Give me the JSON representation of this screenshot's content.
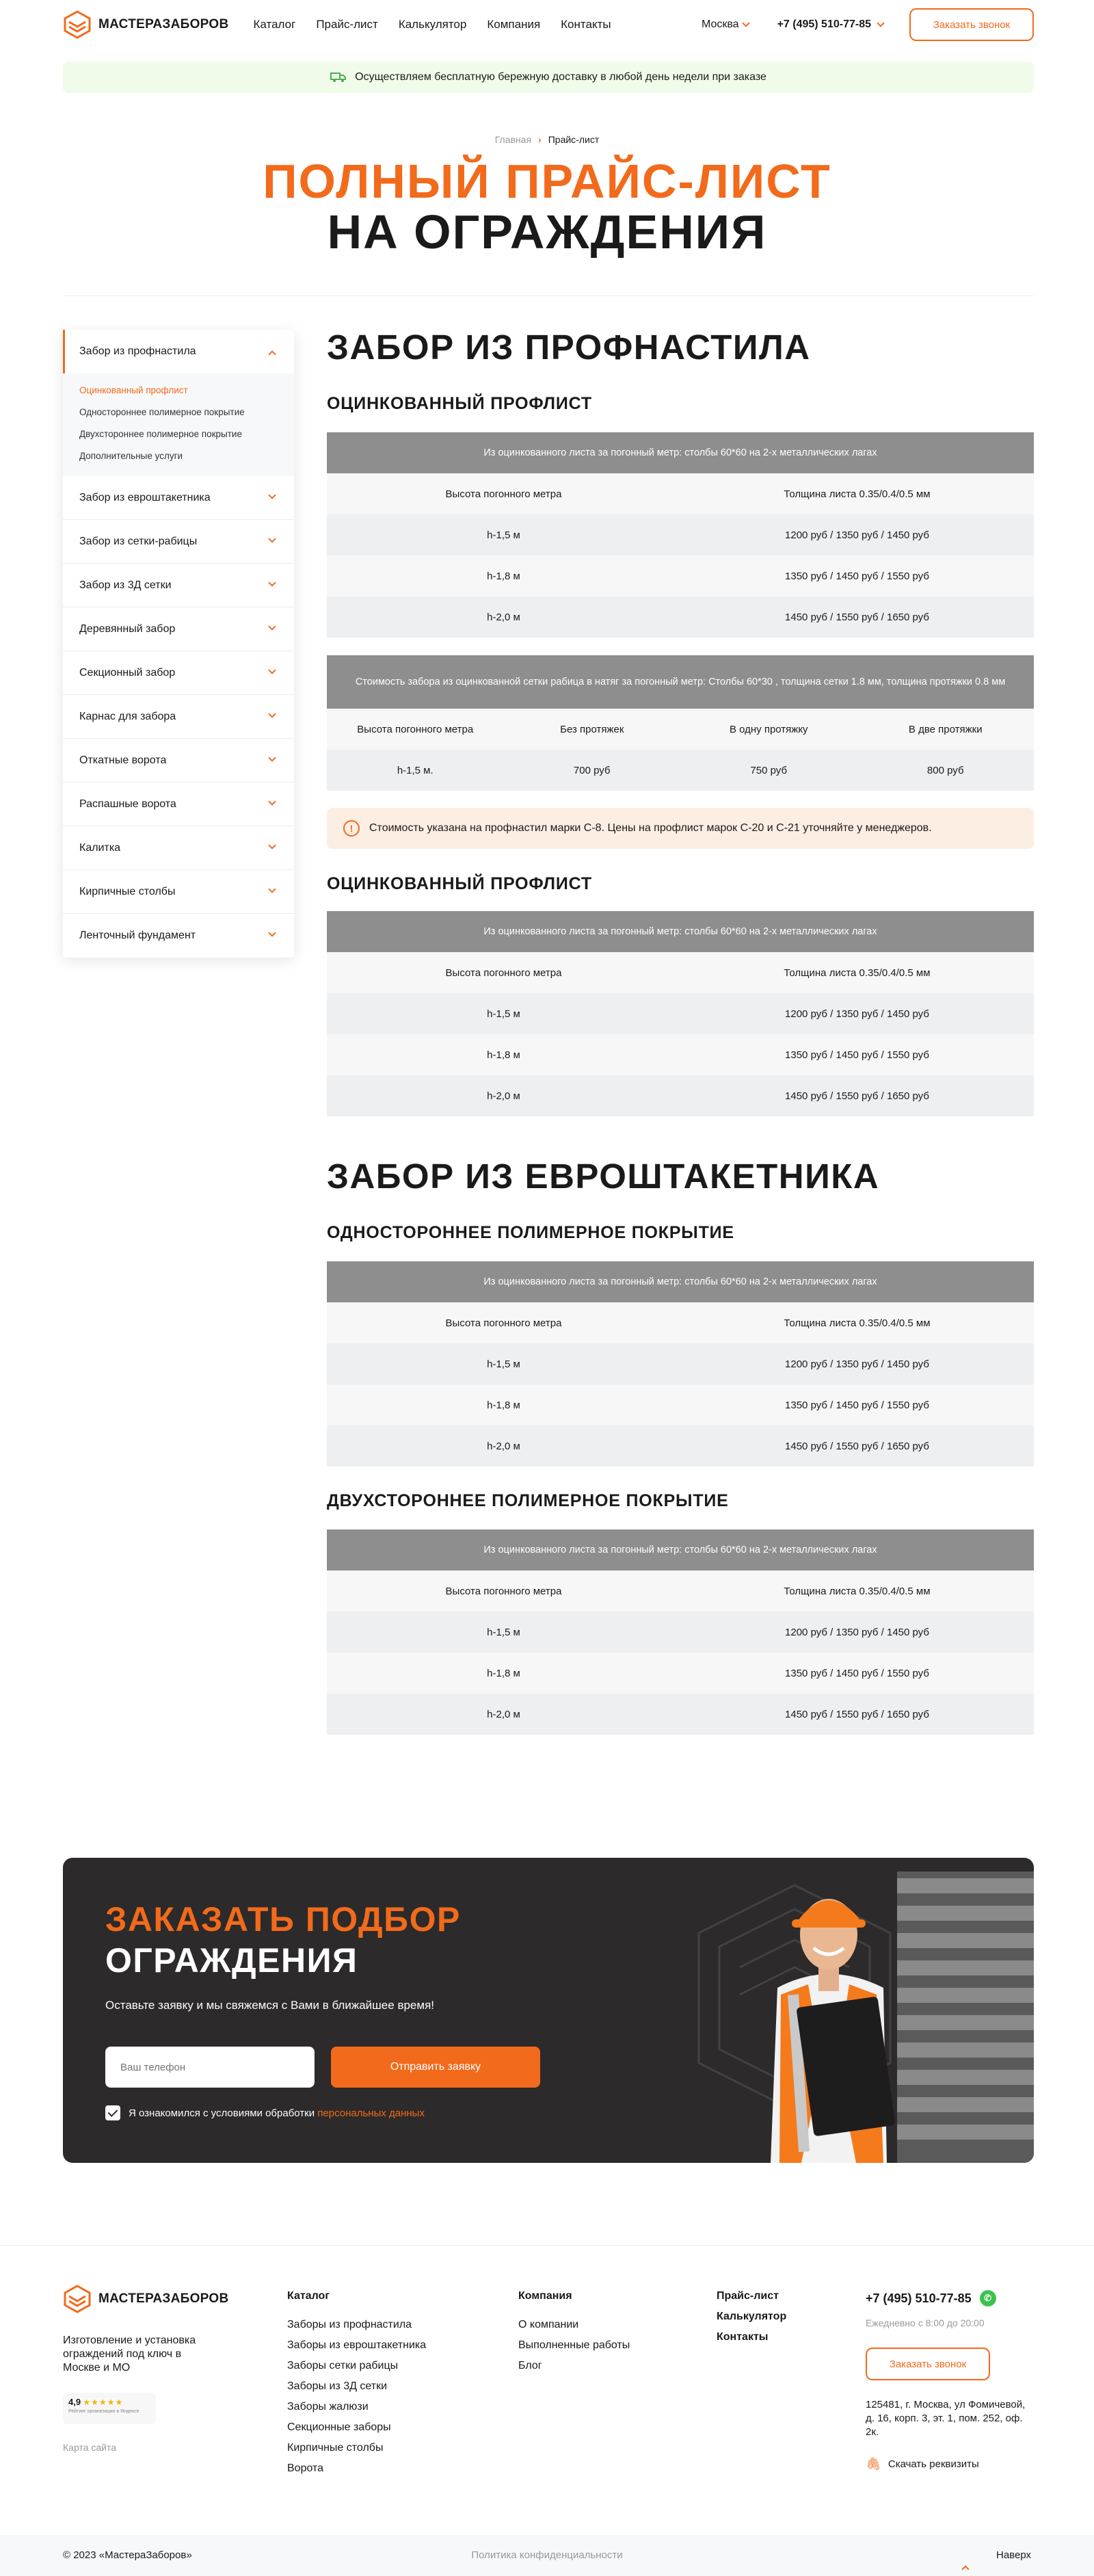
{
  "header": {
    "logo_text": "МАСТЕРАЗАБОРОВ",
    "nav": [
      "Каталог",
      "Прайс-лист",
      "Калькулятор",
      "Компания",
      "Контакты"
    ],
    "city": "Москва",
    "phone": "+7 (495) 510-77-85",
    "callback": "Заказать звонок"
  },
  "banner": {
    "text": "Осуществляем бесплатную бережную доставку в любой день недели при заказе"
  },
  "breadcrumb": {
    "home": "Главная",
    "current": "Прайс-лист"
  },
  "title": {
    "line1": "ПОЛНЫЙ ПРАЙС-ЛИСТ",
    "line2": "НА ОГРАЖДЕНИЯ"
  },
  "sidebar": {
    "open_item": "Забор из профнастила",
    "subitems": [
      "Оцинкованный профлист",
      "Одностороннее полимерное покрытие",
      "Двухстороннее полимерное покрытие",
      "Дополнительные услуги"
    ],
    "items": [
      "Забор из евроштакетника",
      "Забор из сетки-рабицы",
      "Забор из 3Д сетки",
      "Деревянный забор",
      "Секционный забор",
      "Карнас для забора",
      "Откатные ворота",
      "Распашные ворота",
      "Калитка",
      "Кирпичные столбы",
      "Ленточный фундамент"
    ]
  },
  "sections": {
    "s1_title": "ЗАБОР ИЗ ПРОФНАСТИЛА",
    "s1_sub1": "ОЦИНКОВАННЫЙ ПРОФЛИСТ",
    "t1": {
      "head": "Из оцинкованного листа за погонный метр: столбы 60*60 на 2-х металлических лагах",
      "col1": "Высота погонного метра",
      "col2": "Толщина листа 0.35/0.4/0.5 мм",
      "rows": [
        [
          "h-1,5 м",
          "1200 руб / 1350 руб / 1450 руб"
        ],
        [
          "h-1,8 м",
          "1350 руб / 1450 руб / 1550 руб"
        ],
        [
          "h-2,0 м",
          "1450 руб / 1550 руб / 1650 руб"
        ]
      ]
    },
    "t2": {
      "head": "Стоимость забора из оцинкованной сетки рабица в натяг за погонный метр: Столбы 60*30 , толщина сетки 1.8 мм, толщина протяжки 0.8 мм",
      "cols": [
        "Высота погонного метра",
        "Без протяжек",
        "В одну протяжку",
        "В две протяжки"
      ],
      "row": [
        "h-1,5 м.",
        "700 руб",
        "750 руб",
        "800 руб"
      ]
    },
    "notice": "Стоимость указана на профнастил марки С-8. Цены на профлист марок С-20 и С-21 уточняйте у менеджеров.",
    "s1_sub2": "ОЦИНКОВАННЫЙ ПРОФЛИСТ",
    "t3": {
      "head": "Из оцинкованного листа за погонный метр: столбы 60*60 на 2-х металлических лагах",
      "col1": "Высота погонного метра",
      "col2": "Толщина листа 0.35/0.4/0.5 мм",
      "rows": [
        [
          "h-1,5 м",
          "1200 руб / 1350 руб / 1450 руб"
        ],
        [
          "h-1,8 м",
          "1350 руб / 1450 руб / 1550 руб"
        ],
        [
          "h-2,0 м",
          "1450 руб / 1550 руб / 1650 руб"
        ]
      ]
    },
    "s2_title": "ЗАБОР ИЗ ЕВРОШТАКЕТНИКА",
    "s2_sub1": "ОДНОСТОРОННЕЕ ПОЛИМЕРНОЕ ПОКРЫТИЕ",
    "t4": {
      "head": "Из оцинкованного листа за погонный метр: столбы 60*60 на 2-х металлических лагах",
      "col1": "Высота погонного метра",
      "col2": "Толщина листа 0.35/0.4/0.5 мм",
      "rows": [
        [
          "h-1,5 м",
          "1200 руб / 1350 руб / 1450 руб"
        ],
        [
          "h-1,8 м",
          "1350 руб / 1450 руб / 1550 руб"
        ],
        [
          "h-2,0 м",
          "1450 руб / 1550 руб / 1650 руб"
        ]
      ]
    },
    "s2_sub2": "ДВУХСТОРОННЕЕ ПОЛИМЕРНОЕ ПОКРЫТИЕ",
    "t5": {
      "head": "Из оцинкованного листа за погонный метр: столбы 60*60 на 2-х металлических лагах",
      "col1": "Высота погонного метра",
      "col2": "Толщина листа 0.35/0.4/0.5 мм",
      "rows": [
        [
          "h-1,5 м",
          "1200 руб / 1350 руб / 1450 руб"
        ],
        [
          "h-1,8 м",
          "1350 руб / 1450 руб / 1550 руб"
        ],
        [
          "h-2,0 м",
          "1450 руб / 1550 руб / 1650 руб"
        ]
      ]
    }
  },
  "cta": {
    "line1": "ЗАКАЗАТЬ ПОДБОР",
    "line2": "ОГРАЖДЕНИЯ",
    "sub": "Оставьте заявку и мы свяжемся с Вами в ближайшее время!",
    "placeholder": "Ваш телефон",
    "button": "Отправить заявку",
    "consent": "Я ознакомился с условиями обработки",
    "consent_link": "персональных данных"
  },
  "footer": {
    "logo_text": "МАСТЕРАЗАБОРОВ",
    "desc": "Изготовление и установка ограждений под ключ в Москве и МО",
    "rating": "4,9",
    "rating_stars": "★★★★★",
    "rating_caption": "Рейтинг организации в Яндексе",
    "sitemap": "Карта сайта",
    "catalog_title": "Каталог",
    "catalog": [
      "Заборы из профнастила",
      "Заборы из евроштакетника",
      "Заборы сетки рабицы",
      "Заборы из 3Д сетки",
      "Заборы жалюзи",
      "Секционные заборы",
      "Кирпичные столбы",
      "Ворота"
    ],
    "company_title": "Компания",
    "company": [
      "О компании",
      "Выполненные работы",
      "Блог"
    ],
    "col3": [
      "Прайс-лист",
      "Калькулятор",
      "Контакты"
    ],
    "phone": "+7 (495) 510-77-85",
    "hours": "Ежедневно с 8:00 до 20:00",
    "callback": "Заказать звонок",
    "address": "125481, г. Москва, ул Фомичевой, д. 16, корп. 3, эт. 1, пом. 252, оф. 2к.",
    "requisites": "Скачать реквизиты",
    "copyright": "© 2023 «МастераЗаборов»",
    "policy": "Политика конфиденциальности",
    "up": "Наверх"
  },
  "colors": {
    "accent": "#f26a1b",
    "dark": "#2c2a2a",
    "table_head": "#8e8e8e"
  }
}
